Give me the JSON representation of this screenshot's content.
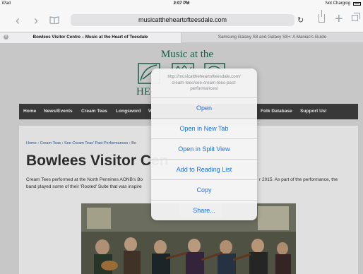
{
  "status_bar": {
    "left": "iPad",
    "time": "2:07 PM",
    "right": "Not Charging"
  },
  "toolbar": {
    "url": "musicattheheartofteesdale.com"
  },
  "tabs": [
    {
      "title": "Bowlees Visitor Centre – Music at the Heart of Teesdale"
    },
    {
      "title": "Samsung Galaxy S8 and Galaxy S8+: A Maniac's Guide"
    }
  ],
  "site": {
    "title_top": "Music at the",
    "title_bottom": "HE",
    "nav": [
      "Home",
      "News/Events",
      "Cream Teas",
      "Longsword",
      "W",
      "Folk Database",
      "Support Us!"
    ],
    "breadcrumb": {
      "link1": "Home",
      "sep1": " › ",
      "link2": "Cream Teas",
      "sep2": " › ",
      "link3": "See Cream Teas' Past Performances",
      "sep3": " › ",
      "current": "Bo"
    },
    "heading": "Bowlees Visitor Cen",
    "paragraph_line1": "Cream Tees performed at the North Pennines AONB's Bo",
    "paragraph_line1_end": "r 2015. As part of the performance, the",
    "paragraph_line2": "band played some of their 'Rooted' Suite that was inspire"
  },
  "popover": {
    "url_lines": [
      "http://musicattheheartofteesdale.com/",
      "cream-tees/see-cream-tees-past-",
      "performances/"
    ],
    "actions": [
      "Open",
      "Open in New Tab",
      "Open in Split View",
      "Add to Reading List",
      "Copy",
      "Share..."
    ]
  },
  "colors": {
    "accent": "#1a6ff2",
    "nav_bg": "#404040",
    "site_green": "#1f6a55"
  }
}
